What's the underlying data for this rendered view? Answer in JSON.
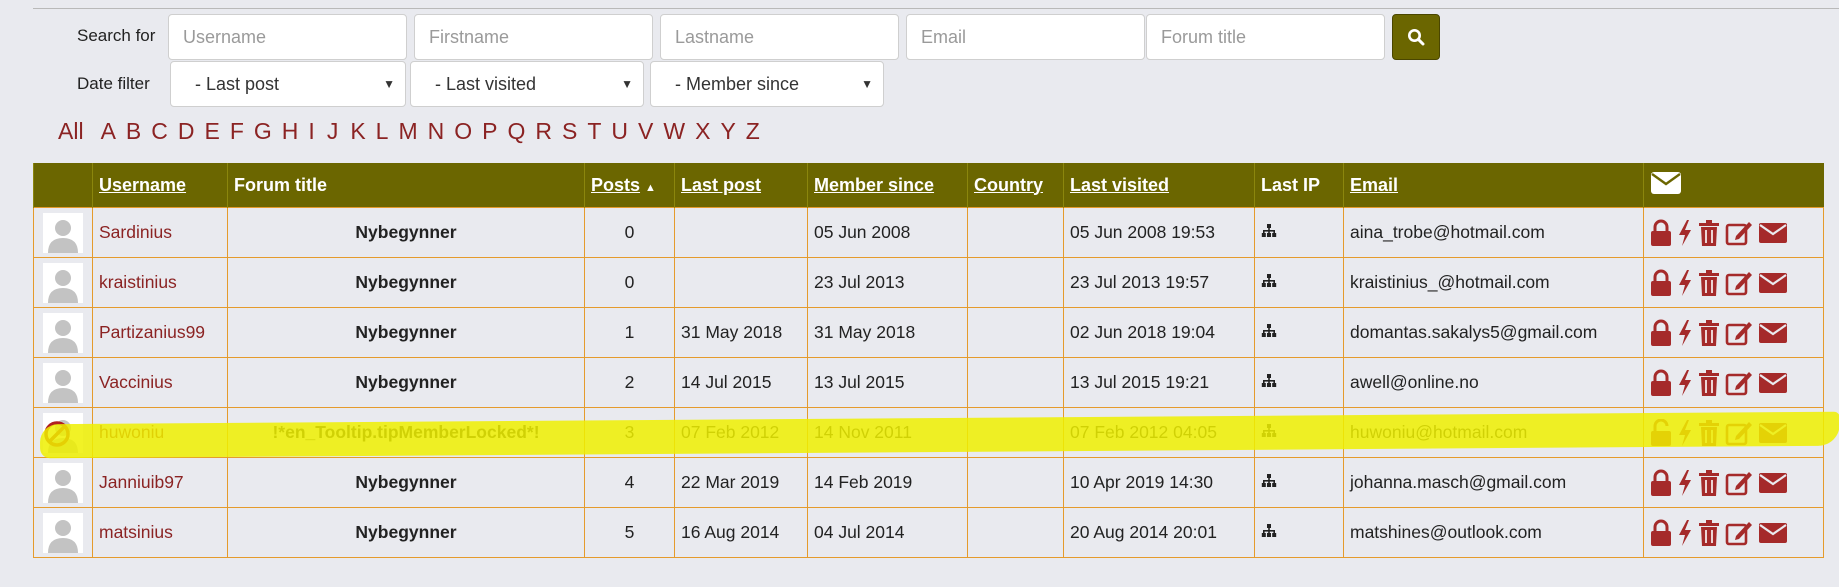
{
  "search": {
    "label": "Search for",
    "placeholders": {
      "username": "Username",
      "firstname": "Firstname",
      "lastname": "Lastname",
      "email": "Email",
      "forum_title": "Forum title"
    }
  },
  "date_filter": {
    "label": "Date filter",
    "last_post": "- Last post",
    "last_visited": "- Last visited",
    "member_since": "- Member since"
  },
  "alphabet": [
    "All",
    "A",
    "B",
    "C",
    "D",
    "E",
    "F",
    "G",
    "H",
    "I",
    "J",
    "K",
    "L",
    "M",
    "N",
    "O",
    "P",
    "Q",
    "R",
    "S",
    "T",
    "U",
    "V",
    "W",
    "X",
    "Y",
    "Z"
  ],
  "table": {
    "headers": {
      "username": "Username",
      "forum_title": "Forum title",
      "posts": "Posts",
      "last_post": "Last post",
      "member_since": "Member since",
      "country": "Country",
      "last_visited": "Last visited",
      "last_ip": "Last IP",
      "email": "Email"
    },
    "rows": [
      {
        "username": "Sardinius",
        "forum_title": "Nybegynner",
        "posts": "0",
        "last_post": "",
        "member_since": "05 Jun 2008",
        "country": "",
        "last_visited": "05 Jun 2008 19:53",
        "email": "aina_trobe@hotmail.com",
        "locked": false
      },
      {
        "username": "kraistinius",
        "forum_title": "Nybegynner",
        "posts": "0",
        "last_post": "",
        "member_since": "23 Jul 2013",
        "country": "",
        "last_visited": "23 Jul 2013 19:57",
        "email": "kraistinius_@hotmail.com",
        "locked": false
      },
      {
        "username": "Partizanius99",
        "forum_title": "Nybegynner",
        "posts": "1",
        "last_post": "31 May 2018",
        "member_since": "31 May 2018",
        "country": "",
        "last_visited": "02 Jun 2018 19:04",
        "email": "domantas.sakalys5@gmail.com",
        "locked": false
      },
      {
        "username": "Vaccinius",
        "forum_title": "Nybegynner",
        "posts": "2",
        "last_post": "14 Jul 2015",
        "member_since": "13 Jul 2015",
        "country": "",
        "last_visited": "13 Jul 2015 19:21",
        "email": "awell@online.no",
        "locked": false
      },
      {
        "username": "huwoniu",
        "forum_title": "!*en_Tooltip.tipMemberLocked*!",
        "posts": "3",
        "last_post": "07 Feb 2012",
        "member_since": "14 Nov 2011",
        "country": "",
        "last_visited": "07 Feb 2012 04:05",
        "email": "huwoniu@hotmail.com",
        "locked": true
      },
      {
        "username": "Janniuib97",
        "forum_title": "Nybegynner",
        "posts": "4",
        "last_post": "22 Mar 2019",
        "member_since": "14 Feb 2019",
        "country": "",
        "last_visited": "10 Apr 2019 14:30",
        "email": "johanna.masch@gmail.com",
        "locked": false
      },
      {
        "username": "matsinius",
        "forum_title": "Nybegynner",
        "posts": "5",
        "last_post": "16 Aug 2014",
        "member_since": "04 Jul 2014",
        "country": "",
        "last_visited": "20 Aug 2014 20:01",
        "email": "matshines@outlook.com",
        "locked": false
      }
    ]
  },
  "colors": {
    "header_bg": "#6b6600",
    "accent_red": "#8b2323",
    "row_border": "#e59b2c",
    "highlight": "#eef000"
  }
}
